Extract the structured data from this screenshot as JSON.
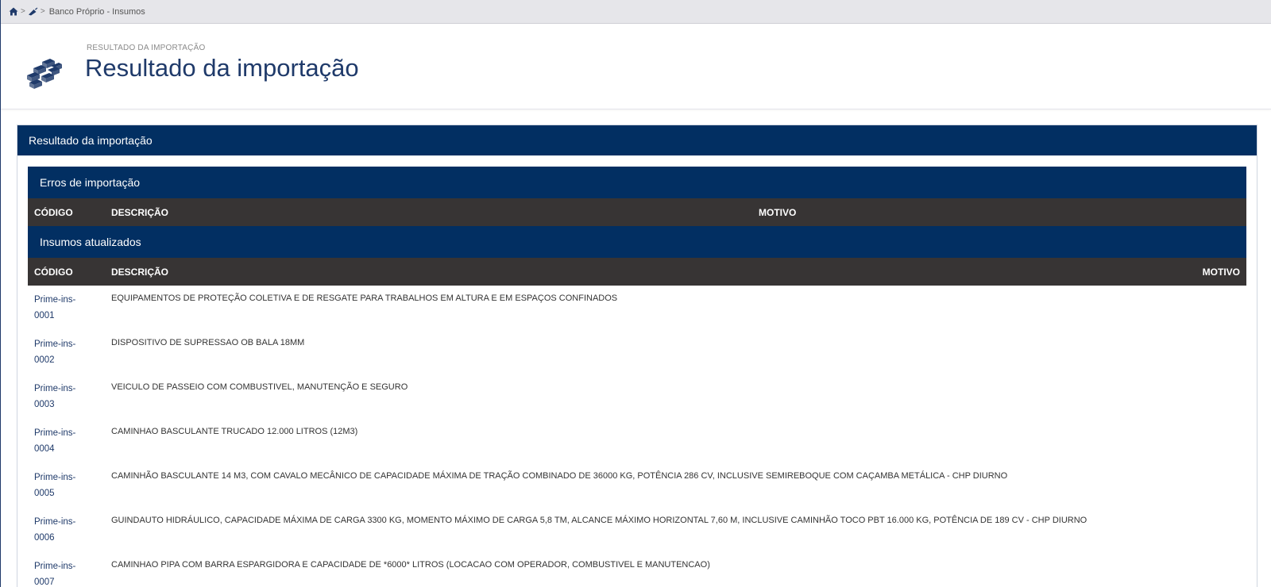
{
  "breadcrumb": {
    "home_icon": "home-icon",
    "trowel_icon": "trowel-icon",
    "separator": ">",
    "label": "Banco Próprio - Insumos"
  },
  "page_header": {
    "icon": "bricks-icon",
    "overline": "RESULTADO DA IMPORTAÇÃO",
    "title": "Resultado da importação"
  },
  "panel": {
    "title": "Resultado da importação",
    "errors_section": {
      "title": "Erros de importação",
      "columns": {
        "code": "CÓDIGO",
        "description": "DESCRIÇÃO",
        "reason": "MOTIVO"
      }
    },
    "updated_section": {
      "title": "Insumos atualizados",
      "columns": {
        "code": "CÓDIGO",
        "description": "DESCRIÇÃO",
        "reason": "MOTIVO"
      },
      "rows": [
        {
          "code": "Prime-ins-0001",
          "description": "EQUIPAMENTOS DE PROTEÇÃO COLETIVA E DE RESGATE PARA TRABALHOS EM ALTURA E EM ESPAÇOS CONFINADOS"
        },
        {
          "code": "Prime-ins-0002",
          "description": "DISPOSITIVO DE SUPRESSAO OB BALA 18MM"
        },
        {
          "code": "Prime-ins-0003",
          "description": "VEICULO DE PASSEIO COM COMBUSTIVEL, MANUTENÇÃO E SEGURO"
        },
        {
          "code": "Prime-ins-0004",
          "description": "CAMINHAO BASCULANTE TRUCADO 12.000 LITROS (12M3)"
        },
        {
          "code": "Prime-ins-0005",
          "description": "CAMINHÃO BASCULANTE 14 M3, COM CAVALO MECÂNICO DE CAPACIDADE MÁXIMA DE TRAÇÃO COMBINADO DE 36000 KG, POTÊNCIA 286 CV, INCLUSIVE SEMIREBOQUE COM CAÇAMBA METÁLICA - CHP DIURNO"
        },
        {
          "code": "Prime-ins-0006",
          "description": "GUINDAUTO HIDRÁULICO, CAPACIDADE MÁXIMA DE CARGA 3300 KG, MOMENTO MÁXIMO DE CARGA 5,8 TM, ALCANCE MÁXIMO HORIZONTAL 7,60 M, INCLUSIVE CAMINHÃO TOCO PBT 16.000 KG, POTÊNCIA DE 189 CV - CHP DIURNO"
        },
        {
          "code": "Prime-ins-0007",
          "description": "CAMINHAO PIPA COM BARRA ESPARGIDORA E CAPACIDADE DE *6000* LITROS (LOCACAO COM OPERADOR, COMBUSTIVEL E MANUTENCAO)"
        }
      ]
    }
  },
  "colors": {
    "navy": "#022f62",
    "table_head": "#373434",
    "link_blue": "#1f3a6a",
    "breadcrumb_bg": "#e6e6ea"
  }
}
